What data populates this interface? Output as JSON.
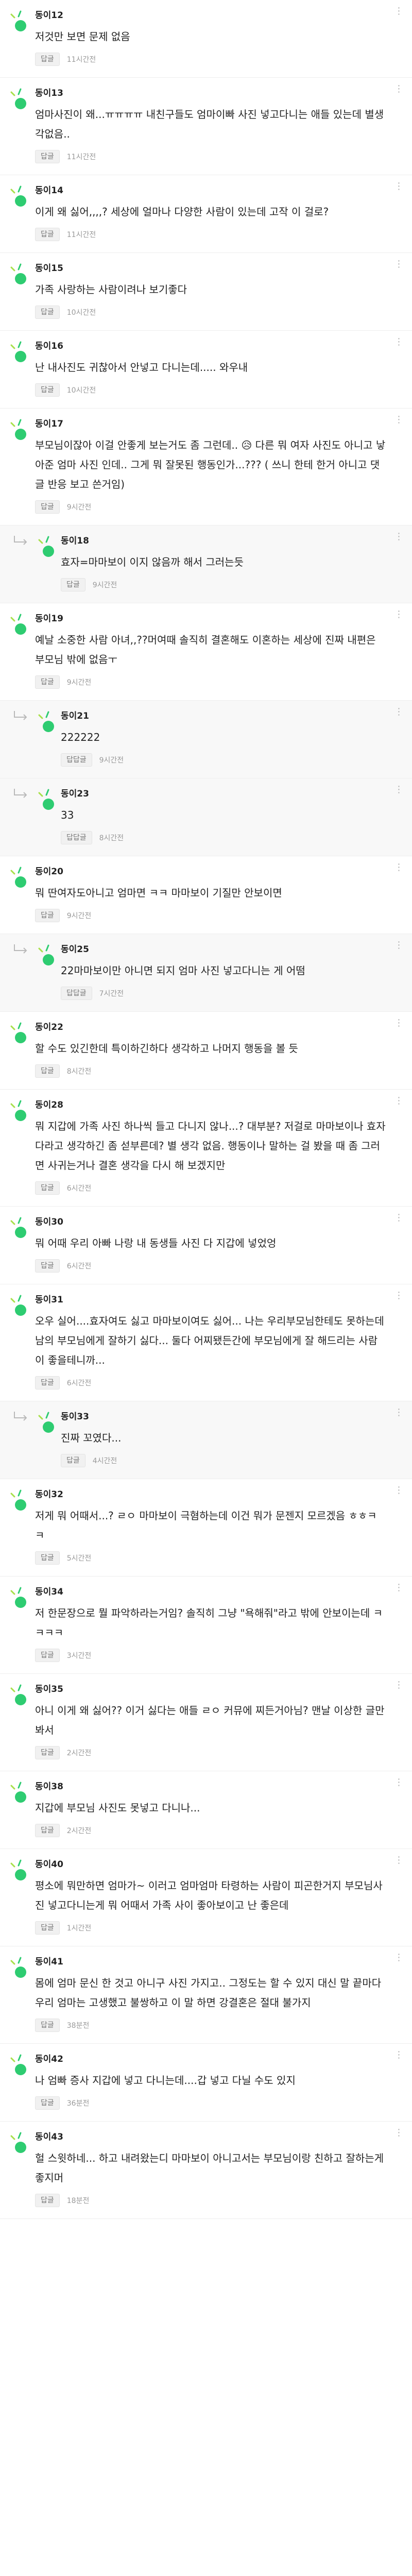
{
  "comments": [
    {
      "nick": "동이12",
      "text": "저것만 보면 문제 없음",
      "reply": "답글",
      "time": "11시간전",
      "is_reply": false
    },
    {
      "nick": "동이13",
      "text": "엄마사진이 왜...ㅠㅠㅠㅠ 내친구들도 엄마이빠 사진 넣고다니는 애들 있는데 별생각없음..",
      "reply": "답글",
      "time": "11시간전",
      "is_reply": false
    },
    {
      "nick": "동이14",
      "text": "이게 왜 싫어,,,,? 세상에 얼마나 다양한 사람이 있는데 고작 이 걸로?",
      "reply": "답글",
      "time": "11시간전",
      "is_reply": false
    },
    {
      "nick": "동이15",
      "text": "가족 사랑하는 사람이려나 보기좋다",
      "reply": "답글",
      "time": "10시간전",
      "is_reply": false
    },
    {
      "nick": "동이16",
      "text": "난 내사진도 귀찮아서 안넣고 다니는데..... 와우내",
      "reply": "답글",
      "time": "10시간전",
      "is_reply": false
    },
    {
      "nick": "동이17",
      "text": "부모님이잖아 이걸 안좋게 보는거도 좀 그런데.. 😥 다른 뭐 여자 사진도 아니고 낳아준 엄마 사진 인데.. 그게 뭐 잘못된 행동인가...??? ( 쓰니 한테 한거 아니고 댓글 반응 보고 쓴거임)",
      "reply": "답글",
      "time": "9시간전",
      "is_reply": false
    },
    {
      "nick": "동이18",
      "text": "효자=마마보이 이지 않음까 해서 그러는듯",
      "reply": "답글",
      "time": "9시간전",
      "is_reply": true
    },
    {
      "nick": "동이19",
      "text": "예날 소중한 사람 아녀,,??머여때 솔직히 결혼해도 이혼하는 세상에 진짜 내편은 부모님 밖에 없음ㅜ",
      "reply": "답글",
      "time": "9시간전",
      "is_reply": false
    },
    {
      "nick": "동이21",
      "text": "222222",
      "reply": "답답글",
      "time": "9시간전",
      "is_reply": true
    },
    {
      "nick": "동이23",
      "text": "33",
      "reply": "답답글",
      "time": "8시간전",
      "is_reply": true
    },
    {
      "nick": "동이20",
      "text": "뭐 딴여자도아니고 엄마면 ㅋㅋ 마마보이 기질만 안보이면",
      "reply": "답글",
      "time": "9시간전",
      "is_reply": false
    },
    {
      "nick": "동이25",
      "text": "22마마보이만 아니면 되지 엄마 사진 넣고다니는 게 어떰",
      "reply": "답답글",
      "time": "7시간전",
      "is_reply": true
    },
    {
      "nick": "동이22",
      "text": "할 수도 있긴한데 특이하긴하다 생각하고 나머지 행동을 볼 듯",
      "reply": "답글",
      "time": "8시간전",
      "is_reply": false
    },
    {
      "nick": "동이28",
      "text": "뭐 지갑에 가족 사진 하나씩 들고 다니지 않나...? 대부분? 저걸로 마마보이나 효자다라고 생각하긴 좀 섣부른데? 별 생각 없음. 행동이나 말하는 걸 봤을 때 좀 그러면 사귀는거나 결혼 생각을 다시 해 보겠지만",
      "reply": "답글",
      "time": "6시간전",
      "is_reply": false
    },
    {
      "nick": "동이30",
      "text": "뭐 어때 우리 아빠 나랑 내 동생들 사진 다 지갑에 넣었엉",
      "reply": "답글",
      "time": "6시간전",
      "is_reply": false
    },
    {
      "nick": "동이31",
      "text": "오우 실어....효자여도 싫고 마마보이여도 싫어... 나는 우리부모님한테도 못하는데 남의 부모님에게 잘하기 싫다... 둘다 어찌됐든간에 부모님에게 잘 해드리는 사람이 좋을테니까...",
      "reply": "답글",
      "time": "6시간전",
      "is_reply": false
    },
    {
      "nick": "동이33",
      "text": "진짜 꼬였다...",
      "reply": "답글",
      "time": "4시간전",
      "is_reply": true
    },
    {
      "nick": "동이32",
      "text": "저게 뭐 어때서...? ㄹㅇ 마마보이 극혐하는데 이건 뭐가 문젠지 모르겠음 ㅎㅎㅋㅋ",
      "reply": "답글",
      "time": "5시간전",
      "is_reply": false
    },
    {
      "nick": "동이34",
      "text": "저 한문장으로 뭘 파악하라는거임? 솔직히 그냥 \"욕해줘\"라고 밖에 안보이는데 ㅋㅋㅋㅋ",
      "reply": "답글",
      "time": "3시간전",
      "is_reply": false
    },
    {
      "nick": "동이35",
      "text": "아니 이게 왜 싫어?? 이거 싫다는 애들 ㄹㅇ 커뮤에 찌든거아님? 맨날 이상한 글만 봐서",
      "reply": "답글",
      "time": "2시간전",
      "is_reply": false
    },
    {
      "nick": "동이38",
      "text": "지갑에 부모님 사진도 못넣고 다니나...",
      "reply": "답글",
      "time": "2시간전",
      "is_reply": false
    },
    {
      "nick": "동이40",
      "text": "평소에 뭐만하면 엄마가~ 이러고 엄마엄마 타령하는 사람이 피곤한거지 부모님사진 넣고다니는게 뭐 어때서 가족 사이 좋아보이고 난 좋은데",
      "reply": "답글",
      "time": "1시간전",
      "is_reply": false
    },
    {
      "nick": "동이41",
      "text": "몸에 엄마 문신 한 것고 아니구 사진 가지고.. 그정도는 할 수 있지 대신 말 끝마다 우리 엄마는 고생했고 불쌍하고 이 말 하면 강결혼은 절대 불가지",
      "reply": "답글",
      "time": "38분전",
      "is_reply": false
    },
    {
      "nick": "동이42",
      "text": "나 엄빠 증사 지갑에 넣고 다니는데....갑 넣고 다닐 수도 있지",
      "reply": "답글",
      "time": "36분전",
      "is_reply": false
    },
    {
      "nick": "동이43",
      "text": "헐 스윗하네... 하고 내려왔는디 마마보이 아니고서는 부모님이랑 친하고 잘하는게 좋지머",
      "reply": "답글",
      "time": "18분전",
      "is_reply": false
    }
  ],
  "icons": {
    "avatar": "green-dot-avatar-icon",
    "more": "more-dots-icon",
    "reply_arrow": "reply-arrow-icon"
  },
  "colors": {
    "avatar_green": "#2ecc71",
    "avatar_accent": "#a8e04a"
  }
}
